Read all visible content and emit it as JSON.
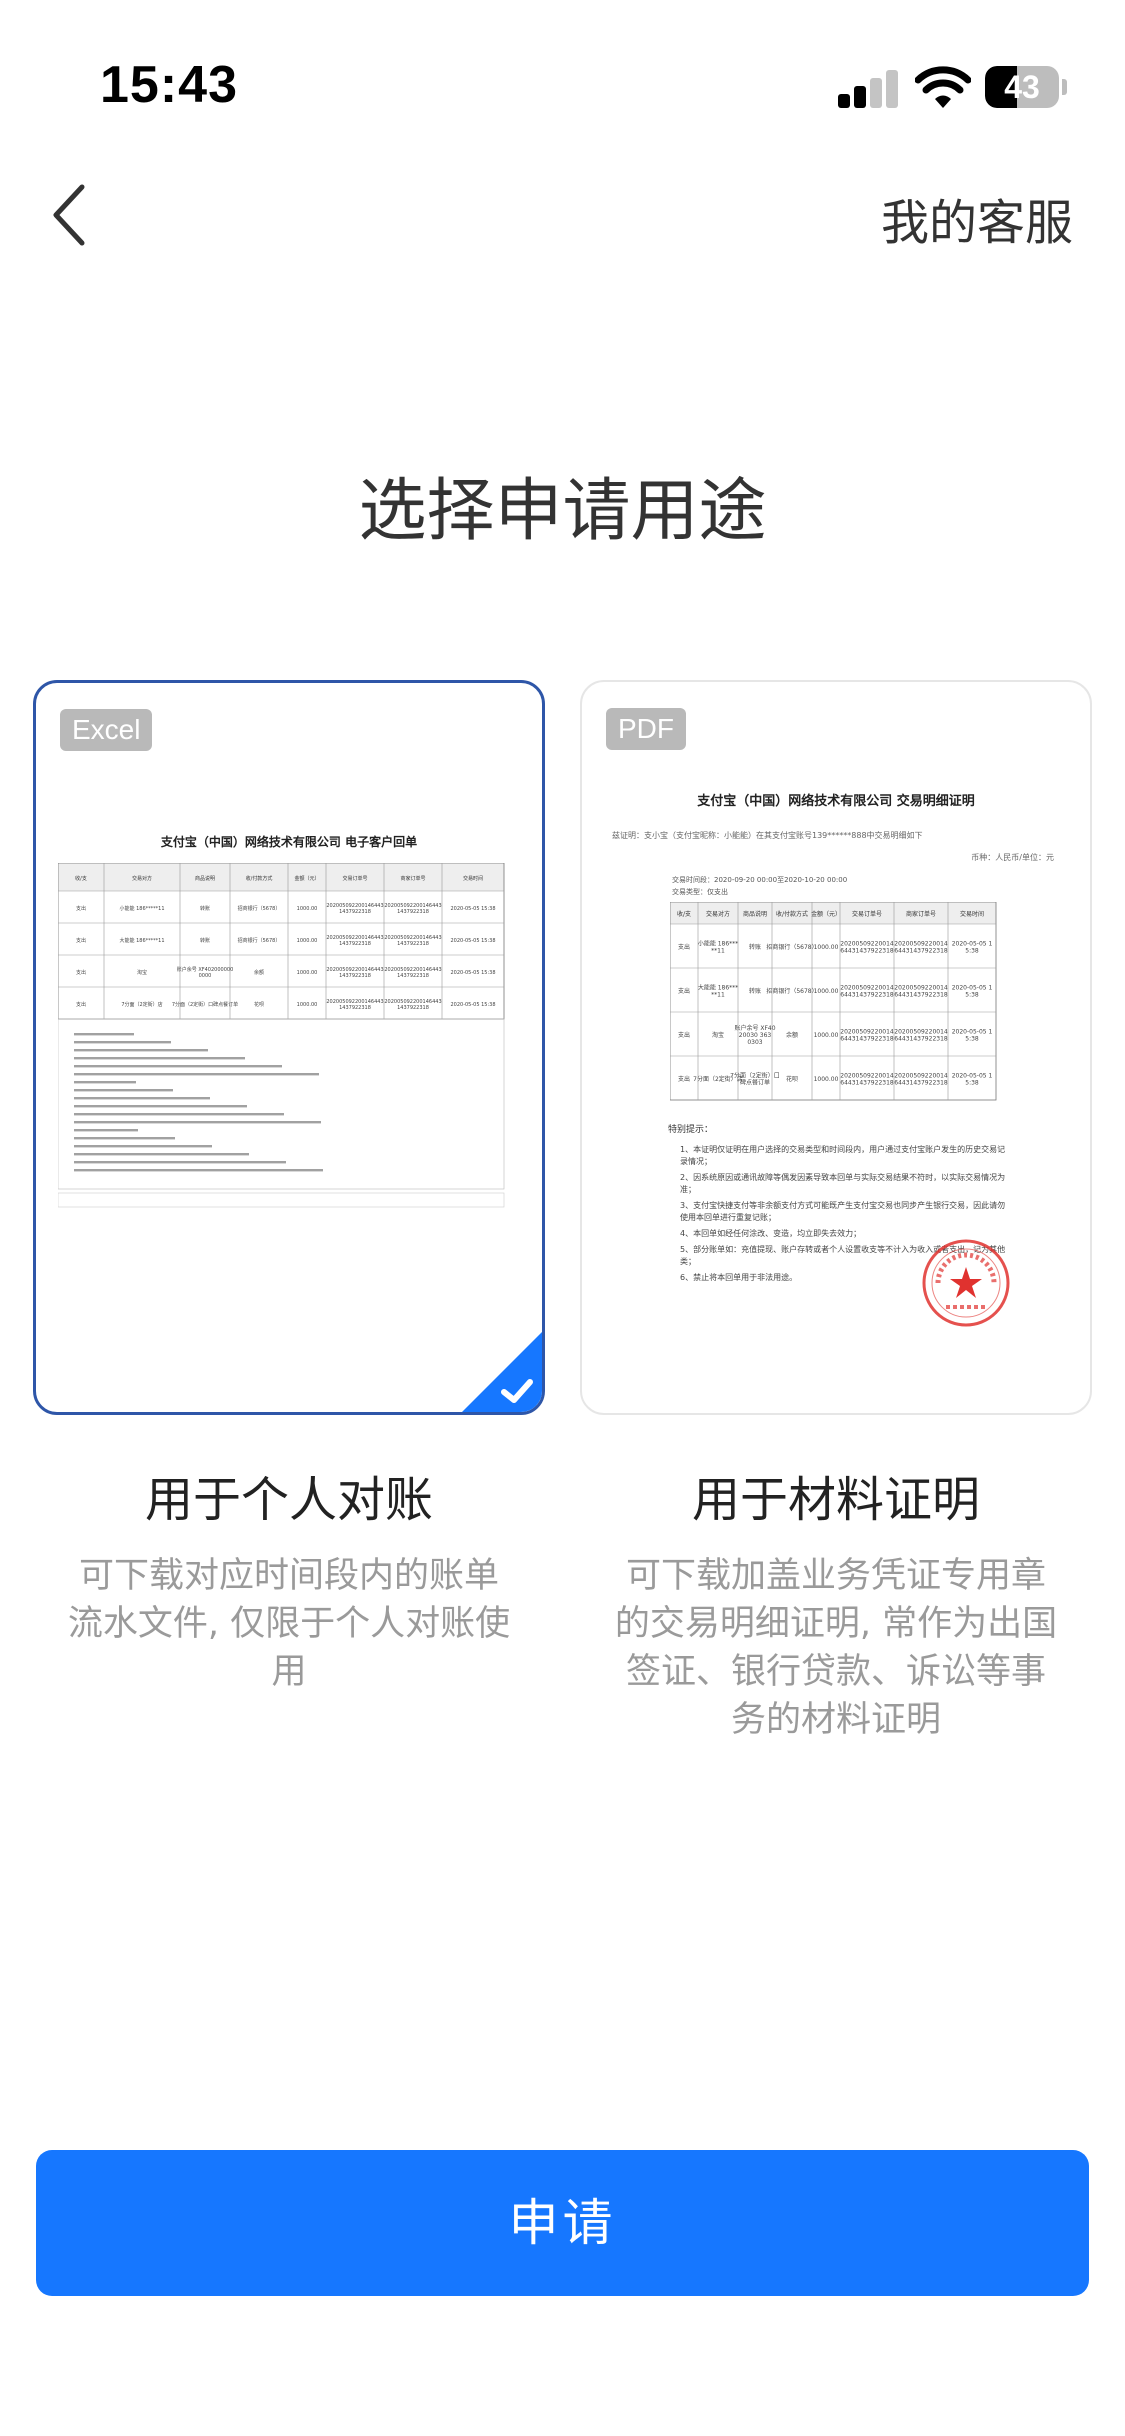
{
  "status_bar": {
    "time": "15:43",
    "battery": "43",
    "battery_level": 0.43
  },
  "nav": {
    "back_icon": "chevron-left-icon",
    "service_label": "我的客服"
  },
  "title": "选择申请用途",
  "cards": [
    {
      "badge": "Excel",
      "doc_title": "支付宝（中国）网络技术有限公司  电子客户回单",
      "table_headers": [
        "收/支",
        "交易对方",
        "商品说明",
        "收/付款方式",
        "金额（元）",
        "交易订单号",
        "商家订单号",
        "交易时间"
      ],
      "rows": [
        [
          "支出",
          "小能能 186*****11",
          "转账",
          "招商银行（5678）",
          "1000.00",
          "2020050922001464431437922318",
          "2020050922001464431437922318",
          "2020-05-05 15:38"
        ],
        [
          "支出",
          "大能能 186*****11",
          "转账",
          "招商银行（5678）",
          "1000.00",
          "2020050922001464431437922318",
          "2020050922001464431437922318",
          "2020-05-05 15:38"
        ],
        [
          "支出",
          "淘宝",
          "账户余号 XF4020000000000",
          "余额",
          "1000.00",
          "2020050922001464431437922318",
          "2020050922001464431437922318",
          "2020-05-05 15:38"
        ],
        [
          "支出",
          "7分面（2定街）店",
          "7分面（2定街）口碑点餐订单",
          "花呗",
          "1000.00",
          "2020050922001464431437922318",
          "2020050922001464431437922318",
          "2020-05-05 15:38"
        ]
      ],
      "selected": true,
      "label": "用于个人对账",
      "description": "可下载对应时间段内的账单流水文件, 仅限于个人对账使用"
    },
    {
      "badge": "PDF",
      "doc_title": "支付宝（中国）网络技术有限公司   交易明细证明",
      "intro": "兹证明：支小宝（支付宝昵称：小能能）在其支付宝账号139******888中交易明细如下",
      "currency_note": "币种：人民币/单位：元",
      "period": "交易时间段：2020-09-20 00:00至2020-10-20 00:00",
      "type": "交易类型：仅支出",
      "table_headers": [
        "收/支",
        "交易对方",
        "商品说明",
        "收/付款方式",
        "金额（元）",
        "交易订单号",
        "商家订单号",
        "交易时间"
      ],
      "rows": [
        [
          "支出",
          "小能能 186*****11",
          "转账",
          "招商银行（5678）",
          "1000.00",
          "2020050922001464431437922318",
          "2020050922001464431437922318",
          "2020-05-05 15:38"
        ],
        [
          "支出",
          "大能能 186*****11",
          "转账",
          "招商银行（5678）",
          "1000.00",
          "2020050922001464431437922318",
          "2020050922001464431437922318",
          "2020-05-05 15:38"
        ],
        [
          "支出",
          "淘宝",
          "账户余号 XF4020030 3630303",
          "余额",
          "1000.00",
          "2020050922001464431437922318",
          "2020050922001464431437922318",
          "2020-05-05 15:38"
        ],
        [
          "支出",
          "7分面（2定街）店",
          "7分面（2定街）口碑点餐订单",
          "花呗",
          "1000.00",
          "2020050922001464431437922318",
          "2020050922001464431437922318",
          "2020-05-05 15:38"
        ]
      ],
      "notes_title": "特别提示：",
      "notes": [
        "1、本证明仅证明在用户选择的交易类型和时间段内，用户通过支付宝账户发生的历史交易记录情况；",
        "2、因系统原因或通讯故障等偶发因素导致本回单与实际交易结果不符时，以实际交易情况为准；",
        "3、支付宝快捷支付等非余额支付方式可能既产生支付宝交易也同步产生银行交易，因此请勿使用本回单进行重复记账；",
        "4、本回单如经任何涂改、变造，均立即失去效力；",
        "5、部分账单如：充值提现、账户存转或者个人设置收支等不计入为收入或者支出，记为其他类；",
        "6、禁止将本回单用于非法用途。"
      ],
      "selected": false,
      "label": "用于材料证明",
      "description": "可下载加盖业务凭证专用章的交易明细证明, 常作为出国签证、银行贷款、诉讼等事务的材料证明"
    }
  ],
  "apply_button": "申请",
  "colors": {
    "primary": "#1677ff",
    "selected_border": "#2e56a8",
    "stamp": "#e0322f"
  }
}
